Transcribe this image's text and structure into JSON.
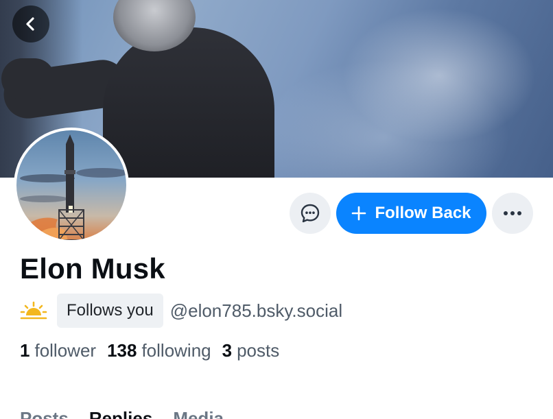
{
  "profile": {
    "display_name": "Elon Musk",
    "follows_you": "Follows you",
    "handle": "@elon785.bsky.social"
  },
  "actions": {
    "follow_label": "Follow Back"
  },
  "stats": {
    "followers_count": "1",
    "followers_label": "follower",
    "following_count": "138",
    "following_label": "following",
    "posts_count": "3",
    "posts_label": "posts"
  },
  "tabs": [
    {
      "label": "Posts"
    },
    {
      "label": "Replies"
    },
    {
      "label": "Media"
    }
  ],
  "icons": {
    "back": "chevron-left-icon",
    "message": "chat-bubble-icon",
    "follow": "plus-icon",
    "more": "ellipsis-icon",
    "status": "sunrise-icon"
  },
  "colors": {
    "accent": "#0a84ff",
    "badge_bg": "#eef1f4",
    "button_bg": "#eceff3",
    "muted_text": "#4f5b68"
  }
}
